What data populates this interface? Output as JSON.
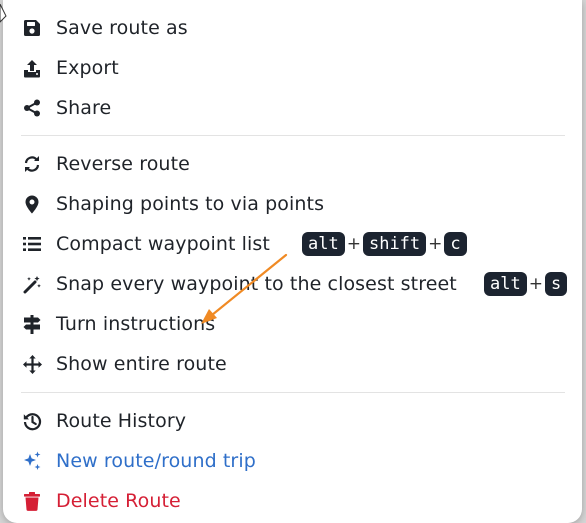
{
  "menu": {
    "sections": [
      [
        {
          "label": "Save route as",
          "icon": "floppy-disk-icon"
        },
        {
          "label": "Export",
          "icon": "upload-icon"
        },
        {
          "label": "Share",
          "icon": "share-icon"
        }
      ],
      [
        {
          "label": "Reverse route",
          "icon": "refresh-icon"
        },
        {
          "label": "Shaping points to via points",
          "icon": "location-pin-icon"
        },
        {
          "label": "Compact waypoint list",
          "icon": "list-icon"
        },
        {
          "label": "Snap every waypoint to the closest street",
          "icon": "magic-wand-icon"
        },
        {
          "label": "Turn instructions",
          "icon": "signpost-icon"
        },
        {
          "label": "Show entire route",
          "icon": "move-arrows-icon"
        }
      ],
      [
        {
          "label": "Route History",
          "icon": "history-icon"
        },
        {
          "label": "New route/round trip",
          "icon": "sparkles-icon",
          "color": "#2f6fc9"
        },
        {
          "label": "Delete Route",
          "icon": "trash-icon",
          "color": "#d51f35"
        }
      ]
    ]
  },
  "shortcuts": {
    "compact": {
      "k1": "alt",
      "k2": "shift",
      "k3": "c",
      "sep": "+"
    },
    "snap": {
      "k1": "alt",
      "k2": "s",
      "sep": "+"
    }
  },
  "annotation": {
    "color": "#f08a24",
    "type": "arrow"
  }
}
